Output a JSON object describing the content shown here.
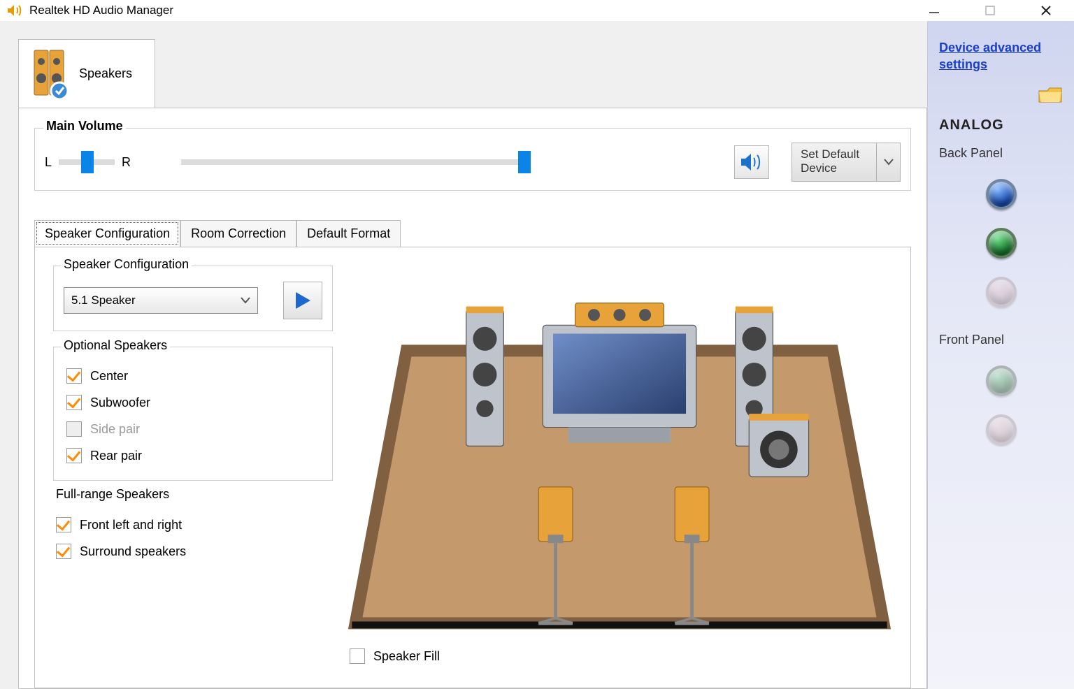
{
  "window": {
    "title": "Realtek HD Audio Manager"
  },
  "deviceTab": {
    "label": "Speakers"
  },
  "volume": {
    "legend": "Main Volume",
    "left_label": "L",
    "right_label": "R"
  },
  "defaultDevice": {
    "label": "Set Default\nDevice"
  },
  "tabs": {
    "speaker_config": "Speaker Configuration",
    "room_correction": "Room Correction",
    "default_format": "Default Format"
  },
  "speakerConfig": {
    "legend": "Speaker Configuration",
    "selected": "5.1 Speaker"
  },
  "optional": {
    "legend": "Optional Speakers",
    "center": "Center",
    "subwoofer": "Subwoofer",
    "side_pair": "Side pair",
    "rear_pair": "Rear pair"
  },
  "fullrange": {
    "legend": "Full-range Speakers",
    "front_lr": "Front left and right",
    "surround": "Surround speakers"
  },
  "speaker_fill": "Speaker Fill",
  "side": {
    "adv_link": "Device advanced settings",
    "analog": "ANALOG",
    "back_panel": "Back Panel",
    "front_panel": "Front Panel"
  }
}
